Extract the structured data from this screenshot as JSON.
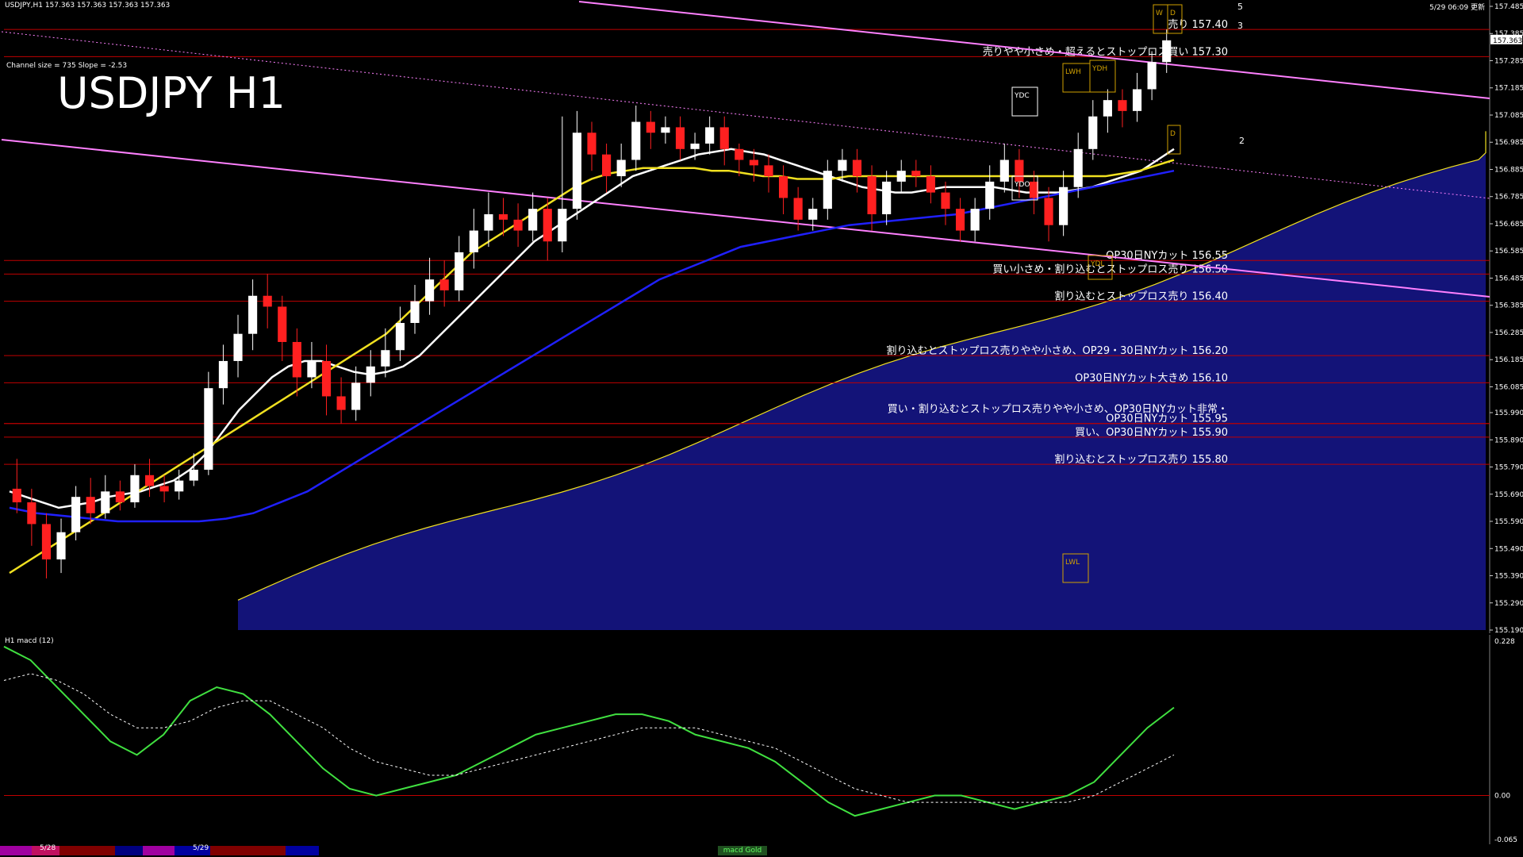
{
  "header": {
    "symbol_info": "USDJPY,H1  157.363 157.363 157.363 157.363",
    "timestamp": "5/29 06:09 更新",
    "channel_info": "Channel size = 735 Slope = -2.53",
    "chart_title": "USDJPY H1",
    "macd_label": "H1  macd (12)"
  },
  "colors": {
    "background": "#000000",
    "candle_up": "#ffffff",
    "candle_down": "#ff2020",
    "sma_white": "#ffffff",
    "sma_yellow": "#f0e020",
    "sma_blue": "#2020ff",
    "chikou_green": "#20c020",
    "level_line": "#c00000",
    "channel_line": "#ff80ff",
    "kumo": "#1a1aa0",
    "macd_line": "#40e040",
    "macd_signal": "#ffffff"
  },
  "chart_data": [
    {
      "type": "candlestick",
      "title": "USDJPY H1",
      "ylim": [
        155.19,
        157.485
      ],
      "y_ticks": [
        "157.485",
        "157.385",
        "157.285",
        "157.185",
        "157.085",
        "156.985",
        "156.885",
        "156.785",
        "156.685",
        "156.585",
        "156.485",
        "156.385",
        "156.285",
        "156.185",
        "156.085",
        "155.990",
        "155.890",
        "155.790",
        "155.690",
        "155.590",
        "155.490",
        "155.390",
        "155.290",
        "155.190"
      ],
      "current_price": "157.363",
      "levels": [
        {
          "price": 157.4,
          "label": "売り 157.40"
        },
        {
          "price": 157.3,
          "label": "売りやや小さめ・超えるとストップロス買い 157.30"
        },
        {
          "price": 156.55,
          "label": "OP30日NYカット 156.55"
        },
        {
          "price": 156.5,
          "label": "買い小さめ・割り込むとストップロス売り 156.50"
        },
        {
          "price": 156.4,
          "label": "割り込むとストップロス売り 156.40"
        },
        {
          "price": 156.2,
          "label": "割り込むとストップロス売りやや小さめ、OP29・30日NYカット 156.20"
        },
        {
          "price": 156.1,
          "label": "OP30日NYカット大きめ 156.10"
        },
        {
          "price": 155.95,
          "label": "買い・割り込むとストップロス売りやや小さめ、OP30日NYカット非常・"
        },
        {
          "price": 155.95,
          "label": "OP30日NYカット 155.95"
        },
        {
          "price": 155.9,
          "label": "買い、OP30日NYカット 155.90"
        },
        {
          "price": 155.8,
          "label": "割り込むとストップロス売り 155.80"
        }
      ],
      "box_labels": [
        "YDC",
        "YDO",
        "LWH",
        "YDH",
        "YDL",
        "LWL",
        "W",
        "D",
        "D"
      ],
      "wave_labels": [
        "5",
        "3",
        "2"
      ],
      "candles": [
        [
          155.71,
          155.66,
          155.82,
          155.62
        ],
        [
          155.66,
          155.58,
          155.71,
          155.5
        ],
        [
          155.58,
          155.45,
          155.62,
          155.38
        ],
        [
          155.45,
          155.55,
          155.6,
          155.4
        ],
        [
          155.55,
          155.68,
          155.72,
          155.52
        ],
        [
          155.68,
          155.62,
          155.75,
          155.58
        ],
        [
          155.62,
          155.7,
          155.76,
          155.6
        ],
        [
          155.7,
          155.66,
          155.74,
          155.63
        ],
        [
          155.66,
          155.76,
          155.8,
          155.64
        ],
        [
          155.76,
          155.72,
          155.82,
          155.68
        ],
        [
          155.72,
          155.7,
          155.76,
          155.66
        ],
        [
          155.7,
          155.74,
          155.78,
          155.67
        ],
        [
          155.74,
          155.78,
          155.84,
          155.72
        ],
        [
          155.78,
          156.08,
          156.14,
          155.76
        ],
        [
          156.08,
          156.18,
          156.24,
          156.02
        ],
        [
          156.18,
          156.28,
          156.35,
          156.12
        ],
        [
          156.28,
          156.42,
          156.48,
          156.22
        ],
        [
          156.42,
          156.38,
          156.5,
          156.3
        ],
        [
          156.38,
          156.25,
          156.42,
          156.18
        ],
        [
          156.25,
          156.12,
          156.3,
          156.05
        ],
        [
          156.12,
          156.18,
          156.25,
          156.08
        ],
        [
          156.18,
          156.05,
          156.24,
          155.98
        ],
        [
          156.05,
          156.0,
          156.12,
          155.95
        ],
        [
          156.0,
          156.1,
          156.16,
          155.96
        ],
        [
          156.1,
          156.16,
          156.22,
          156.05
        ],
        [
          156.16,
          156.22,
          156.3,
          156.12
        ],
        [
          156.22,
          156.32,
          156.38,
          156.18
        ],
        [
          156.32,
          156.4,
          156.46,
          156.28
        ],
        [
          156.4,
          156.48,
          156.56,
          156.35
        ],
        [
          156.48,
          156.44,
          156.55,
          156.38
        ],
        [
          156.44,
          156.58,
          156.64,
          156.4
        ],
        [
          156.58,
          156.66,
          156.74,
          156.52
        ],
        [
          156.66,
          156.72,
          156.8,
          156.6
        ],
        [
          156.72,
          156.7,
          156.78,
          156.64
        ],
        [
          156.7,
          156.66,
          156.76,
          156.6
        ],
        [
          156.66,
          156.74,
          156.8,
          156.62
        ],
        [
          156.74,
          156.62,
          156.78,
          156.55
        ],
        [
          156.62,
          156.74,
          157.08,
          156.58
        ],
        [
          156.74,
          157.02,
          157.1,
          156.7
        ],
        [
          157.02,
          156.94,
          157.06,
          156.88
        ],
        [
          156.94,
          156.86,
          156.98,
          156.8
        ],
        [
          156.86,
          156.92,
          156.98,
          156.82
        ],
        [
          156.92,
          157.06,
          157.12,
          156.88
        ],
        [
          157.06,
          157.02,
          157.1,
          156.96
        ],
        [
          157.02,
          157.04,
          157.08,
          156.98
        ],
        [
          157.04,
          156.96,
          157.08,
          156.92
        ],
        [
          156.96,
          156.98,
          157.02,
          156.92
        ],
        [
          156.98,
          157.04,
          157.08,
          156.94
        ],
        [
          157.04,
          156.96,
          157.08,
          156.9
        ],
        [
          156.96,
          156.92,
          156.98,
          156.86
        ],
        [
          156.92,
          156.9,
          156.96,
          156.84
        ],
        [
          156.9,
          156.86,
          156.94,
          156.8
        ],
        [
          156.86,
          156.78,
          156.9,
          156.72
        ],
        [
          156.78,
          156.7,
          156.82,
          156.66
        ],
        [
          156.7,
          156.74,
          156.78,
          156.66
        ],
        [
          156.74,
          156.88,
          156.92,
          156.7
        ],
        [
          156.88,
          156.92,
          156.96,
          156.84
        ],
        [
          156.92,
          156.86,
          156.96,
          156.8
        ],
        [
          156.86,
          156.72,
          156.9,
          156.66
        ],
        [
          156.72,
          156.84,
          156.88,
          156.68
        ],
        [
          156.84,
          156.88,
          156.92,
          156.8
        ],
        [
          156.88,
          156.86,
          156.92,
          156.82
        ],
        [
          156.86,
          156.8,
          156.9,
          156.76
        ],
        [
          156.8,
          156.74,
          156.84,
          156.68
        ],
        [
          156.74,
          156.66,
          156.78,
          156.62
        ],
        [
          156.66,
          156.74,
          156.78,
          156.62
        ],
        [
          156.74,
          156.84,
          156.9,
          156.7
        ],
        [
          156.84,
          156.92,
          156.98,
          156.8
        ],
        [
          156.92,
          156.84,
          156.96,
          156.78
        ],
        [
          156.84,
          156.78,
          156.88,
          156.72
        ],
        [
          156.78,
          156.68,
          156.82,
          156.62
        ],
        [
          156.68,
          156.82,
          156.88,
          156.64
        ],
        [
          156.82,
          156.96,
          157.02,
          156.78
        ],
        [
          156.96,
          157.08,
          157.14,
          156.92
        ],
        [
          157.08,
          157.14,
          157.18,
          157.02
        ],
        [
          157.14,
          157.1,
          157.18,
          157.04
        ],
        [
          157.1,
          157.18,
          157.24,
          157.06
        ],
        [
          157.18,
          157.28,
          157.32,
          157.14
        ],
        [
          157.28,
          157.36,
          157.4,
          157.24
        ]
      ],
      "moving_averages": [
        {
          "name": "sma_white",
          "values": [
            155.7,
            155.68,
            155.66,
            155.64,
            155.65,
            155.66,
            155.68,
            155.69,
            155.7,
            155.72,
            155.74,
            155.78,
            155.84,
            155.92,
            156.0,
            156.06,
            156.12,
            156.16,
            156.18,
            156.18,
            156.16,
            156.14,
            156.13,
            156.14,
            156.16,
            156.2,
            156.26,
            156.32,
            156.38,
            156.44,
            156.5,
            156.56,
            156.62,
            156.66,
            156.7,
            156.74,
            156.78,
            156.82,
            156.86,
            156.88,
            156.9,
            156.92,
            156.94,
            156.95,
            156.96,
            156.95,
            156.94,
            156.92,
            156.9,
            156.88,
            156.86,
            156.84,
            156.82,
            156.81,
            156.8,
            156.8,
            156.81,
            156.82,
            156.82,
            156.82,
            156.82,
            156.81,
            156.8,
            156.8,
            156.8,
            156.81,
            156.82,
            156.84,
            156.86,
            156.88,
            156.92,
            156.96
          ]
        },
        {
          "name": "sma_yellow",
          "values": [
            155.4,
            155.44,
            155.48,
            155.52,
            155.56,
            155.6,
            155.64,
            155.68,
            155.72,
            155.76,
            155.8,
            155.84,
            155.88,
            155.92,
            155.96,
            156.0,
            156.04,
            156.08,
            156.12,
            156.16,
            156.2,
            156.24,
            156.28,
            156.34,
            156.4,
            156.46,
            156.52,
            156.58,
            156.62,
            156.66,
            156.7,
            156.74,
            156.78,
            156.82,
            156.85,
            156.87,
            156.88,
            156.89,
            156.89,
            156.89,
            156.89,
            156.88,
            156.88,
            156.87,
            156.86,
            156.86,
            156.85,
            156.85,
            156.85,
            156.86,
            156.86,
            156.86,
            156.86,
            156.86,
            156.86,
            156.86,
            156.86,
            156.86,
            156.86,
            156.86,
            156.86,
            156.86,
            156.86,
            156.86,
            156.86,
            156.87,
            156.88,
            156.9,
            156.92
          ]
        },
        {
          "name": "sma_blue",
          "values": [
            155.64,
            155.62,
            155.61,
            155.6,
            155.59,
            155.59,
            155.59,
            155.59,
            155.6,
            155.62,
            155.66,
            155.7,
            155.76,
            155.82,
            155.88,
            155.94,
            156.0,
            156.06,
            156.12,
            156.18,
            156.24,
            156.3,
            156.36,
            156.42,
            156.48,
            156.52,
            156.56,
            156.6,
            156.62,
            156.64,
            156.66,
            156.68,
            156.69,
            156.7,
            156.71,
            156.72,
            156.74,
            156.76,
            156.78,
            156.8,
            156.82,
            156.84,
            156.86,
            156.88
          ]
        }
      ]
    },
    {
      "type": "line",
      "title": "H1  macd (12)",
      "ylim": [
        -0.065,
        0.228
      ],
      "y_ticks": [
        "0.228",
        "0.00",
        "-0.065"
      ],
      "series": [
        {
          "name": "macd",
          "values": [
            0.22,
            0.2,
            0.16,
            0.12,
            0.08,
            0.06,
            0.09,
            0.14,
            0.16,
            0.15,
            0.12,
            0.08,
            0.04,
            0.01,
            0.0,
            0.01,
            0.02,
            0.03,
            0.05,
            0.07,
            0.09,
            0.1,
            0.11,
            0.12,
            0.12,
            0.11,
            0.09,
            0.08,
            0.07,
            0.05,
            0.02,
            -0.01,
            -0.03,
            -0.02,
            -0.01,
            0.0,
            0.0,
            -0.01,
            -0.02,
            -0.01,
            0.0,
            0.02,
            0.06,
            0.1,
            0.13
          ]
        },
        {
          "name": "signal",
          "values": [
            0.17,
            0.18,
            0.17,
            0.15,
            0.12,
            0.1,
            0.1,
            0.11,
            0.13,
            0.14,
            0.14,
            0.12,
            0.1,
            0.07,
            0.05,
            0.04,
            0.03,
            0.03,
            0.04,
            0.05,
            0.06,
            0.07,
            0.08,
            0.09,
            0.1,
            0.1,
            0.1,
            0.09,
            0.08,
            0.07,
            0.05,
            0.03,
            0.01,
            0.0,
            -0.01,
            -0.01,
            -0.01,
            -0.01,
            -0.01,
            -0.01,
            -0.01,
            0.0,
            0.02,
            0.04,
            0.06
          ]
        }
      ]
    }
  ],
  "bottom_bar": {
    "date_1": "5/28",
    "date_2": "5/29",
    "indicator_tab": "macd Gold"
  }
}
